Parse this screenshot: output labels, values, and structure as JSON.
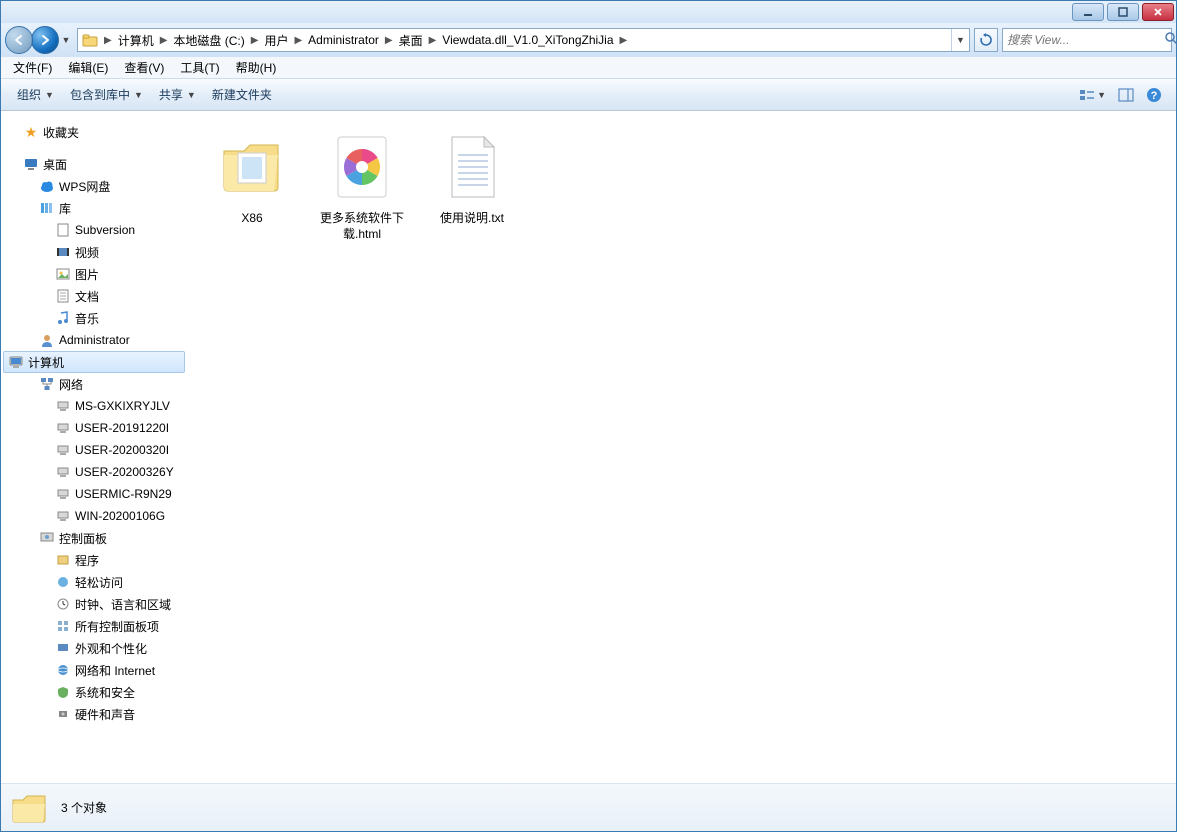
{
  "window": {
    "min_tip": "最小化",
    "max_tip": "最大化",
    "close_tip": "关闭"
  },
  "breadcrumb": [
    "计算机",
    "本地磁盘 (C:)",
    "用户",
    "Administrator",
    "桌面",
    "Viewdata.dll_V1.0_XiTongZhiJia"
  ],
  "search": {
    "placeholder": "搜索 View..."
  },
  "menubar": [
    "文件(F)",
    "编辑(E)",
    "查看(V)",
    "工具(T)",
    "帮助(H)"
  ],
  "toolbar": {
    "organize": "组织",
    "include": "包含到库中",
    "share": "共享",
    "newfolder": "新建文件夹"
  },
  "tree": {
    "favorites": "收藏夹",
    "desktop": "桌面",
    "wps": "WPS网盘",
    "libraries": "库",
    "lib_items": [
      "Subversion",
      "视频",
      "图片",
      "文档",
      "音乐"
    ],
    "admin": "Administrator",
    "computer": "计算机",
    "network": "网络",
    "net_items": [
      "MS-GXKIXRYJLV",
      "USER-20191220I",
      "USER-20200320I",
      "USER-20200326Y",
      "USERMIC-R9N29",
      "WIN-20200106G"
    ],
    "cpl": "控制面板",
    "cpl_items": [
      "程序",
      "轻松访问",
      "时钟、语言和区域",
      "所有控制面板项",
      "外观和个性化",
      "网络和 Internet",
      "系统和安全",
      "硬件和声音"
    ]
  },
  "files": [
    {
      "name": "X86",
      "type": "folder"
    },
    {
      "name": "更多系统软件下载.html",
      "type": "html"
    },
    {
      "name": "使用说明.txt",
      "type": "txt"
    }
  ],
  "status": {
    "count": "3 个对象"
  }
}
